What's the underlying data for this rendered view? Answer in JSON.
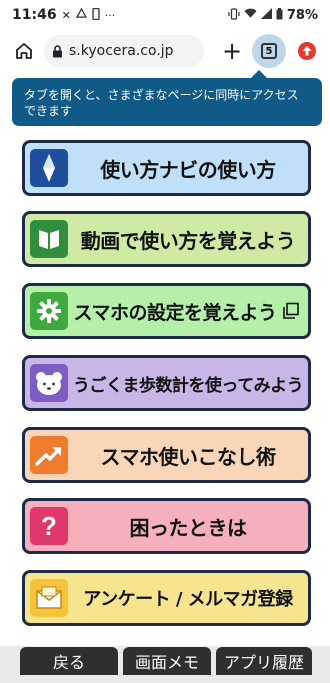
{
  "status_bar": {
    "time": "11:46",
    "battery": "78%",
    "left_icons": [
      "close-icon",
      "drive-icon",
      "phone-icon",
      "more-icon"
    ],
    "right_icons": [
      "vibrate-icon",
      "wifi-icon",
      "signal-icon",
      "battery-icon"
    ]
  },
  "browser": {
    "url": "s.kyocera.co.jp",
    "tab_count": "5"
  },
  "tooltip": {
    "text": "タブを開くと、さまざまなページに同時にアクセスできます"
  },
  "menu": [
    {
      "label": "使い方ナビの使い方",
      "bg": "#bfe0f8",
      "icon_bg": "#1f4f9c",
      "icon": "compass-icon"
    },
    {
      "label": "動画で使い方を覚えよう",
      "bg": "#cfeaa5",
      "icon_bg": "#2f8f3a",
      "icon": "book-icon"
    },
    {
      "label": "スマホの設定を覚えよう",
      "bg": "#b4f0a8",
      "icon_bg": "#3fa83f",
      "icon": "gear-icon"
    },
    {
      "label": "うごくま歩数計を使ってみよう",
      "bg": "#c8b7e6",
      "icon_bg": "#7d5cc4",
      "icon": "bear-icon"
    },
    {
      "label": "スマホ使いこなし術",
      "bg": "#fad6b8",
      "icon_bg": "#f07a2e",
      "icon": "trend-icon"
    },
    {
      "label": "困ったときは",
      "bg": "#f6b0bc",
      "icon_bg": "#e0386b",
      "icon": "question-icon"
    },
    {
      "label": "アンケート / メルマガ登録",
      "bg": "#f7e48f",
      "icon_bg": "#f4c23b",
      "icon": "mail-icon"
    }
  ],
  "bottom_bar": {
    "back": "戻る",
    "memo": "画面メモ",
    "history": "アプリ履歴"
  }
}
